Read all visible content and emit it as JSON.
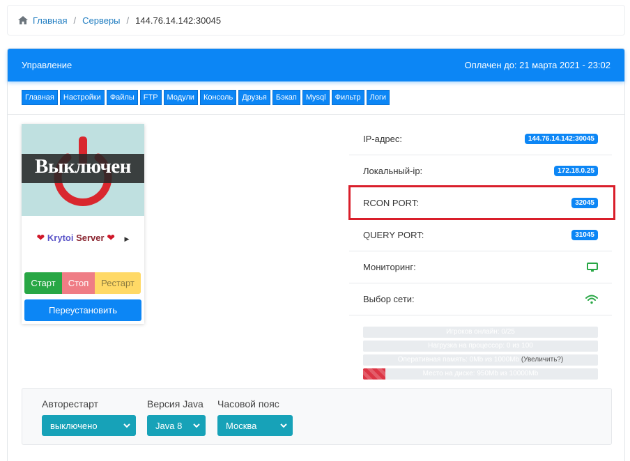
{
  "breadcrumb": {
    "home": "Главная",
    "servers": "Серверы",
    "current": "144.76.14.142:30045"
  },
  "header": {
    "title": "Управление",
    "paid_until": "Оплачен до: 21 марта 2021 - 23:02"
  },
  "tabs": [
    "Главная",
    "Настройки",
    "Файлы",
    "FTP",
    "Модули",
    "Консоль",
    "Друзья",
    "Бэкап",
    "Mysql",
    "Фильтр",
    "Логи"
  ],
  "server": {
    "status": "Выключен",
    "name_part1": "Krytoi",
    "name_part2": "Server",
    "start": "Старт",
    "stop": "Стоп",
    "restart": "Рестарт",
    "reinstall": "Переустановить"
  },
  "info": {
    "ip_label": "IP-адрес:",
    "ip_value": "144.76.14.142:30045",
    "local_ip_label": "Локальный-ip:",
    "local_ip_value": "172.18.0.25",
    "rcon_label": "RCON PORT:",
    "rcon_value": "32045",
    "query_label": "QUERY PORT:",
    "query_value": "31045",
    "monitoring_label": "Мониторинг:",
    "network_label": "Выбор сети:"
  },
  "progress": {
    "players": "Игроков онлайн: 0/25",
    "players_fraction": 0,
    "cpu": "Нагрузка на процессор: 0 из 100",
    "cpu_fraction": 0,
    "ram": "Оперативная память: 0Mb из 1000Mb",
    "ram_fraction": 0,
    "ram_increase": "(Увеличить?)",
    "disk": "Место на диске: 950Mb из 10000Mb",
    "disk_fraction": 0.095
  },
  "settings": {
    "autorestart_label": "Авторестарт",
    "autorestart_value": "выключено",
    "java_label": "Версия Java",
    "java_value": "Java 8",
    "timezone_label": "Часовой пояс",
    "timezone_value": "Москва"
  },
  "colors": {
    "primary": "#0c86f5",
    "success": "#28a745",
    "danger": "#dc3545",
    "info": "#17a2b8",
    "highlight": "#d91e2a"
  }
}
